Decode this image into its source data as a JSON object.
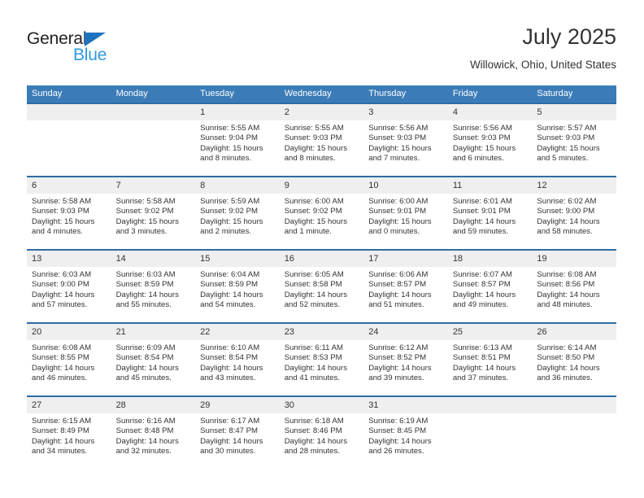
{
  "brand": {
    "name_part1": "General",
    "name_part2": "Blue",
    "triangle_color": "#1f72bd",
    "blue_text_color": "#2e9ae0"
  },
  "header": {
    "title": "July 2025",
    "subtitle": "Willowick, Ohio, United States"
  },
  "theme": {
    "header_blue": "#3b7cb8",
    "row_rule_blue": "#2e6da4",
    "daynum_band": "#efefef",
    "text": "#333333"
  },
  "calendar": {
    "weekday_headers": [
      "Sunday",
      "Monday",
      "Tuesday",
      "Wednesday",
      "Thursday",
      "Friday",
      "Saturday"
    ],
    "weeks": [
      [
        {
          "day": "",
          "sunrise": "",
          "sunset": "",
          "daylight": ""
        },
        {
          "day": "",
          "sunrise": "",
          "sunset": "",
          "daylight": ""
        },
        {
          "day": "1",
          "sunrise": "Sunrise: 5:55 AM",
          "sunset": "Sunset: 9:04 PM",
          "daylight": "Daylight: 15 hours and 8 minutes."
        },
        {
          "day": "2",
          "sunrise": "Sunrise: 5:55 AM",
          "sunset": "Sunset: 9:03 PM",
          "daylight": "Daylight: 15 hours and 8 minutes."
        },
        {
          "day": "3",
          "sunrise": "Sunrise: 5:56 AM",
          "sunset": "Sunset: 9:03 PM",
          "daylight": "Daylight: 15 hours and 7 minutes."
        },
        {
          "day": "4",
          "sunrise": "Sunrise: 5:56 AM",
          "sunset": "Sunset: 9:03 PM",
          "daylight": "Daylight: 15 hours and 6 minutes."
        },
        {
          "day": "5",
          "sunrise": "Sunrise: 5:57 AM",
          "sunset": "Sunset: 9:03 PM",
          "daylight": "Daylight: 15 hours and 5 minutes."
        }
      ],
      [
        {
          "day": "6",
          "sunrise": "Sunrise: 5:58 AM",
          "sunset": "Sunset: 9:03 PM",
          "daylight": "Daylight: 15 hours and 4 minutes."
        },
        {
          "day": "7",
          "sunrise": "Sunrise: 5:58 AM",
          "sunset": "Sunset: 9:02 PM",
          "daylight": "Daylight: 15 hours and 3 minutes."
        },
        {
          "day": "8",
          "sunrise": "Sunrise: 5:59 AM",
          "sunset": "Sunset: 9:02 PM",
          "daylight": "Daylight: 15 hours and 2 minutes."
        },
        {
          "day": "9",
          "sunrise": "Sunrise: 6:00 AM",
          "sunset": "Sunset: 9:02 PM",
          "daylight": "Daylight: 15 hours and 1 minute."
        },
        {
          "day": "10",
          "sunrise": "Sunrise: 6:00 AM",
          "sunset": "Sunset: 9:01 PM",
          "daylight": "Daylight: 15 hours and 0 minutes."
        },
        {
          "day": "11",
          "sunrise": "Sunrise: 6:01 AM",
          "sunset": "Sunset: 9:01 PM",
          "daylight": "Daylight: 14 hours and 59 minutes."
        },
        {
          "day": "12",
          "sunrise": "Sunrise: 6:02 AM",
          "sunset": "Sunset: 9:00 PM",
          "daylight": "Daylight: 14 hours and 58 minutes."
        }
      ],
      [
        {
          "day": "13",
          "sunrise": "Sunrise: 6:03 AM",
          "sunset": "Sunset: 9:00 PM",
          "daylight": "Daylight: 14 hours and 57 minutes."
        },
        {
          "day": "14",
          "sunrise": "Sunrise: 6:03 AM",
          "sunset": "Sunset: 8:59 PM",
          "daylight": "Daylight: 14 hours and 55 minutes."
        },
        {
          "day": "15",
          "sunrise": "Sunrise: 6:04 AM",
          "sunset": "Sunset: 8:59 PM",
          "daylight": "Daylight: 14 hours and 54 minutes."
        },
        {
          "day": "16",
          "sunrise": "Sunrise: 6:05 AM",
          "sunset": "Sunset: 8:58 PM",
          "daylight": "Daylight: 14 hours and 52 minutes."
        },
        {
          "day": "17",
          "sunrise": "Sunrise: 6:06 AM",
          "sunset": "Sunset: 8:57 PM",
          "daylight": "Daylight: 14 hours and 51 minutes."
        },
        {
          "day": "18",
          "sunrise": "Sunrise: 6:07 AM",
          "sunset": "Sunset: 8:57 PM",
          "daylight": "Daylight: 14 hours and 49 minutes."
        },
        {
          "day": "19",
          "sunrise": "Sunrise: 6:08 AM",
          "sunset": "Sunset: 8:56 PM",
          "daylight": "Daylight: 14 hours and 48 minutes."
        }
      ],
      [
        {
          "day": "20",
          "sunrise": "Sunrise: 6:08 AM",
          "sunset": "Sunset: 8:55 PM",
          "daylight": "Daylight: 14 hours and 46 minutes."
        },
        {
          "day": "21",
          "sunrise": "Sunrise: 6:09 AM",
          "sunset": "Sunset: 8:54 PM",
          "daylight": "Daylight: 14 hours and 45 minutes."
        },
        {
          "day": "22",
          "sunrise": "Sunrise: 6:10 AM",
          "sunset": "Sunset: 8:54 PM",
          "daylight": "Daylight: 14 hours and 43 minutes."
        },
        {
          "day": "23",
          "sunrise": "Sunrise: 6:11 AM",
          "sunset": "Sunset: 8:53 PM",
          "daylight": "Daylight: 14 hours and 41 minutes."
        },
        {
          "day": "24",
          "sunrise": "Sunrise: 6:12 AM",
          "sunset": "Sunset: 8:52 PM",
          "daylight": "Daylight: 14 hours and 39 minutes."
        },
        {
          "day": "25",
          "sunrise": "Sunrise: 6:13 AM",
          "sunset": "Sunset: 8:51 PM",
          "daylight": "Daylight: 14 hours and 37 minutes."
        },
        {
          "day": "26",
          "sunrise": "Sunrise: 6:14 AM",
          "sunset": "Sunset: 8:50 PM",
          "daylight": "Daylight: 14 hours and 36 minutes."
        }
      ],
      [
        {
          "day": "27",
          "sunrise": "Sunrise: 6:15 AM",
          "sunset": "Sunset: 8:49 PM",
          "daylight": "Daylight: 14 hours and 34 minutes."
        },
        {
          "day": "28",
          "sunrise": "Sunrise: 6:16 AM",
          "sunset": "Sunset: 8:48 PM",
          "daylight": "Daylight: 14 hours and 32 minutes."
        },
        {
          "day": "29",
          "sunrise": "Sunrise: 6:17 AM",
          "sunset": "Sunset: 8:47 PM",
          "daylight": "Daylight: 14 hours and 30 minutes."
        },
        {
          "day": "30",
          "sunrise": "Sunrise: 6:18 AM",
          "sunset": "Sunset: 8:46 PM",
          "daylight": "Daylight: 14 hours and 28 minutes."
        },
        {
          "day": "31",
          "sunrise": "Sunrise: 6:19 AM",
          "sunset": "Sunset: 8:45 PM",
          "daylight": "Daylight: 14 hours and 26 minutes."
        },
        {
          "day": "",
          "sunrise": "",
          "sunset": "",
          "daylight": ""
        },
        {
          "day": "",
          "sunrise": "",
          "sunset": "",
          "daylight": ""
        }
      ]
    ]
  }
}
